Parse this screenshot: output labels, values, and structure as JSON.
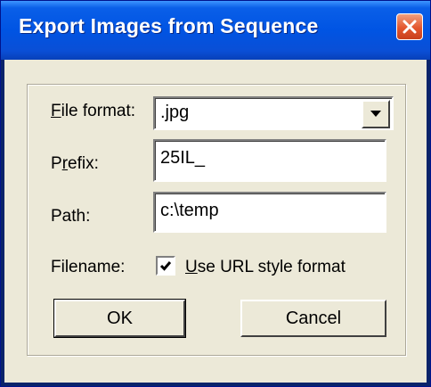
{
  "window": {
    "title": "Export Images from Sequence",
    "close_icon": "close-icon"
  },
  "form": {
    "file_format": {
      "label_accel": "F",
      "label_rest": "ile format:",
      "value": ".jpg"
    },
    "prefix": {
      "label_pre": "P",
      "label_accel": "r",
      "label_rest": "efix:",
      "value": "25IL_"
    },
    "path": {
      "label": "Path:",
      "value": "c:\\temp"
    },
    "filename": {
      "label": "Filename:",
      "checked": true,
      "check_accel": "U",
      "check_rest": "se URL style format"
    }
  },
  "buttons": {
    "ok": "OK",
    "cancel": "Cancel"
  },
  "colors": {
    "titlebar": "#0054e3",
    "face": "#ece9d8",
    "close": "#e4562e"
  }
}
